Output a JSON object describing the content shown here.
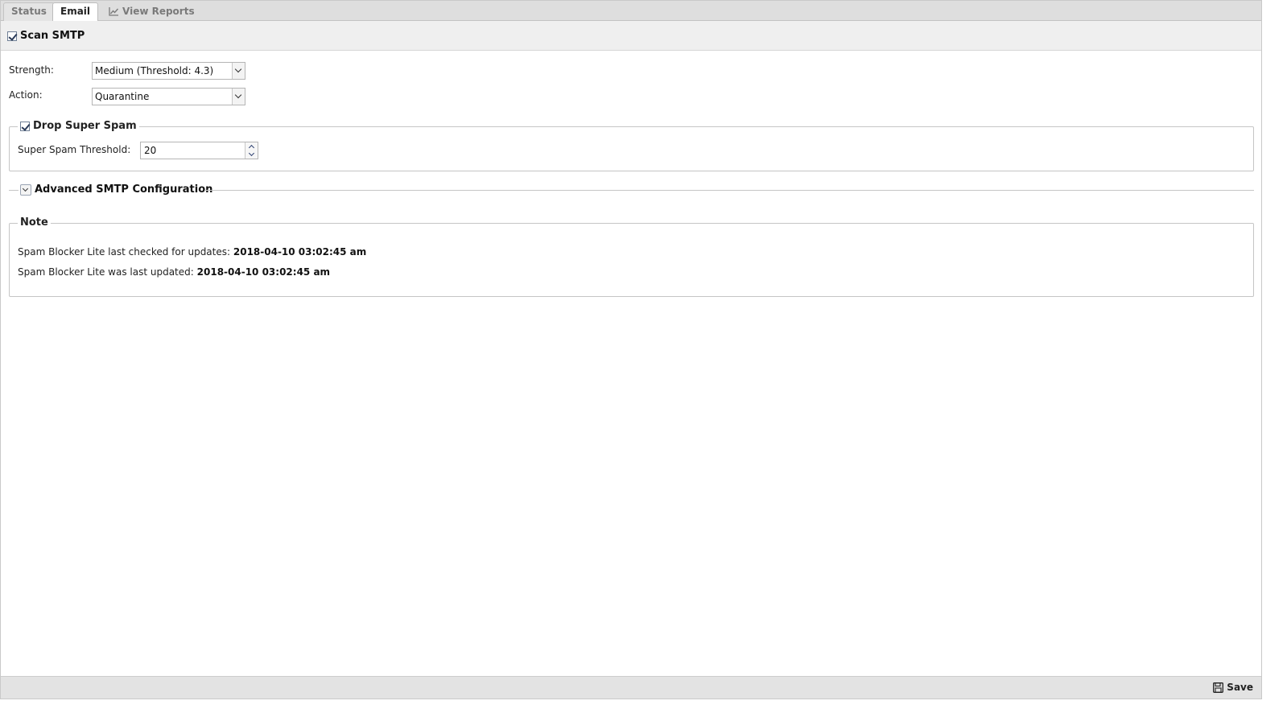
{
  "tabs": [
    {
      "label": "Status",
      "active": false
    },
    {
      "label": "Email",
      "active": true
    },
    {
      "label": "View Reports",
      "icon": "chart-line-icon",
      "active": false
    }
  ],
  "scan_smtp": {
    "label": "Scan SMTP",
    "checked": true
  },
  "strength": {
    "label": "Strength:",
    "value": "Medium (Threshold: 4.3)"
  },
  "action": {
    "label": "Action:",
    "value": "Quarantine"
  },
  "drop_super_spam": {
    "label": "Drop Super Spam",
    "checked": true,
    "threshold_label": "Super Spam Threshold:",
    "threshold_value": "20"
  },
  "advanced": {
    "label": "Advanced SMTP Configuration",
    "collapsed": true
  },
  "note": {
    "title": "Note",
    "checked_label": "Spam Blocker Lite last checked for updates:",
    "checked_value": "2018-04-10 03:02:45 am",
    "updated_label": "Spam Blocker Lite was last updated:",
    "updated_value": "2018-04-10 03:02:45 am"
  },
  "footer": {
    "save_label": "Save",
    "save_icon": "floppy-disk-icon"
  }
}
